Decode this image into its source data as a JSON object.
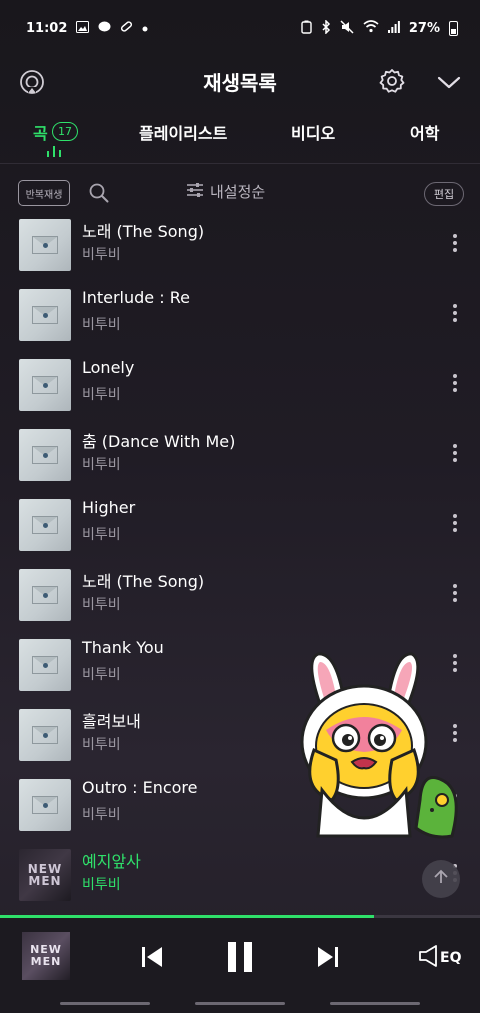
{
  "status_bar": {
    "time": "11:02",
    "battery": "27%"
  },
  "header": {
    "title": "재생목록"
  },
  "tabs": [
    {
      "label": "곡",
      "badge": "17",
      "active": true
    },
    {
      "label": "플레이리스트"
    },
    {
      "label": "비디오"
    },
    {
      "label": "어학"
    }
  ],
  "controls": {
    "repeat_label": "반복재생",
    "sort_label": "내설정순",
    "edit_label": "편집"
  },
  "songs": [
    {
      "title": "노래 (The Song)",
      "artist": "비투비"
    },
    {
      "title": "Interlude : Re",
      "artist": "비투비"
    },
    {
      "title": "Lonely",
      "artist": "비투비"
    },
    {
      "title": "춤 (Dance With Me)",
      "artist": "비투비"
    },
    {
      "title": "Higher",
      "artist": "비투비"
    },
    {
      "title": "노래 (The Song)",
      "artist": "비투비"
    },
    {
      "title": "Thank You",
      "artist": "비투비"
    },
    {
      "title": "흘려보내",
      "artist": "비투비"
    },
    {
      "title": "Outro : Encore",
      "artist": "비투비"
    },
    {
      "title": "예지앞사",
      "artist": "비투비",
      "current": true
    }
  ],
  "player": {
    "album_art_text": "NEW MEN",
    "eq_label": "EQ",
    "progress": 0.78
  },
  "colors": {
    "accent": "#2fe06a",
    "background": "#1e1b22"
  }
}
